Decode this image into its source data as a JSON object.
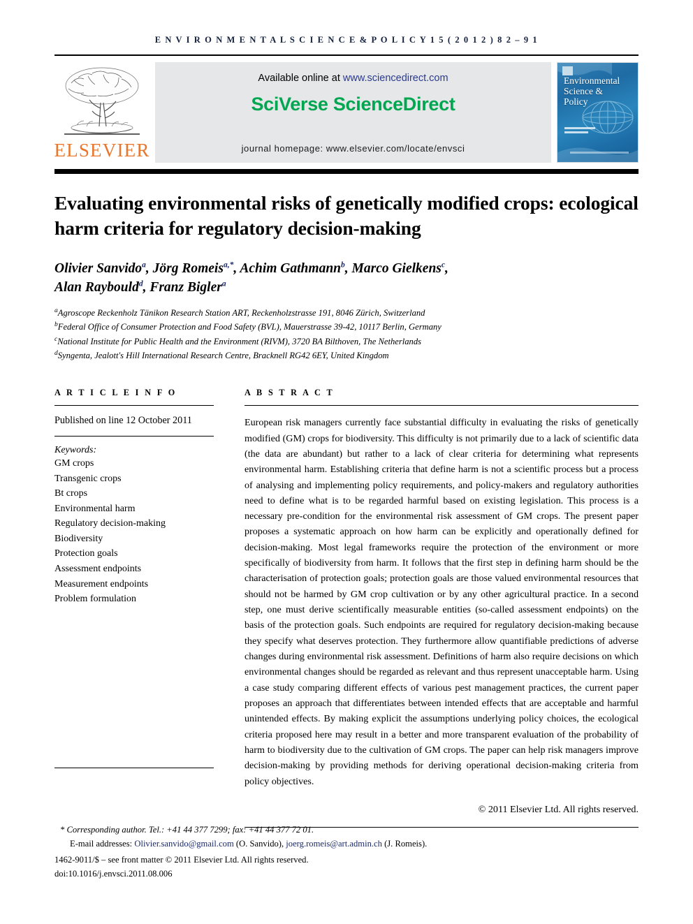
{
  "running_head": "E N V I R O N M E N T A L   S C I E N C E   &   P O L I C Y   1 5   ( 2 0 1 2 )   8 2 – 9 1",
  "masthead": {
    "elsevier_wordmark": "ELSEVIER",
    "available_online_label": "Available online at",
    "sciencedirect_url": "www.sciencedirect.com",
    "sciverse_logo": "SciVerse ScienceDirect",
    "journal_homepage": "journal homepage: www.elsevier.com/locate/envsci",
    "cover_title_line1": "Environmental",
    "cover_title_line2": "Science &",
    "cover_title_line3": "Policy"
  },
  "article": {
    "title": "Evaluating environmental risks of genetically modified crops: ecological harm criteria for regulatory decision-making",
    "authors_line1": "Olivier Sanvido",
    "authors_line1_sup1": "a",
    "authors_line1_b": ", Jörg Romeis",
    "authors_line1_sup2": "a,*",
    "authors_line1_c": ", Achim Gathmann",
    "authors_line1_sup3": "b",
    "authors_line1_d": ", Marco Gielkens",
    "authors_line1_sup4": "c",
    "authors_line1_e": ",",
    "authors_line2": "Alan Raybould",
    "authors_line2_sup1": "d",
    "authors_line2_b": ", Franz Bigler",
    "authors_line2_sup2": "a",
    "affiliations": [
      {
        "marker": "a",
        "text": "Agroscope Reckenholz Tänikon Research Station ART, Reckenholzstrasse 191, 8046 Zürich, Switzerland"
      },
      {
        "marker": "b",
        "text": "Federal Office of Consumer Protection and Food Safety (BVL), Mauerstrasse 39-42, 10117 Berlin, Germany"
      },
      {
        "marker": "c",
        "text": "National Institute for Public Health and the Environment (RIVM), 3720 BA Bilthoven, The Netherlands"
      },
      {
        "marker": "d",
        "text": "Syngenta, Jealott's Hill International Research Centre, Bracknell RG42 6EY, United Kingdom"
      }
    ]
  },
  "article_info": {
    "heading": "A R T I C L E   I N F O",
    "published": "Published on line 12 October 2011",
    "keywords_label": "Keywords:",
    "keywords": [
      "GM crops",
      "Transgenic crops",
      "Bt crops",
      "Environmental harm",
      "Regulatory decision-making",
      "Biodiversity",
      "Protection goals",
      "Assessment endpoints",
      "Measurement endpoints",
      "Problem formulation"
    ]
  },
  "abstract": {
    "heading": "A B S T R A C T",
    "body": "European risk managers currently face substantial difficulty in evaluating the risks of genetically modified (GM) crops for biodiversity. This difficulty is not primarily due to a lack of scientific data (the data are abundant) but rather to a lack of clear criteria for determining what represents environmental harm. Establishing criteria that define harm is not a scientific process but a process of analysing and implementing policy requirements, and policy-makers and regulatory authorities need to define what is to be regarded harmful based on existing legislation. This process is a necessary pre-condition for the environmental risk assessment of GM crops. The present paper proposes a systematic approach on how harm can be explicitly and operationally defined for decision-making. Most legal frameworks require the protection of the environment or more specifically of biodiversity from harm. It follows that the first step in defining harm should be the characterisation of protection goals; protection goals are those valued environmental resources that should not be harmed by GM crop cultivation or by any other agricultural practice. In a second step, one must derive scientifically measurable entities (so-called assessment endpoints) on the basis of the protection goals. Such endpoints are required for regulatory decision-making because they specify what deserves protection. They furthermore allow quantifiable predictions of adverse changes during environmental risk assessment. Definitions of harm also require decisions on which environmental changes should be regarded as relevant and thus represent unacceptable harm. Using a case study comparing different effects of various pest management practices, the current paper proposes an approach that differentiates between intended effects that are acceptable and harmful unintended effects. By making explicit the assumptions underlying policy choices, the ecological criteria proposed here may result in a better and more transparent evaluation of the probability of harm to biodiversity due to the cultivation of GM crops. The paper can help risk managers improve decision-making by providing methods for deriving operational decision-making criteria from policy objectives.",
    "copyright": "© 2011 Elsevier Ltd. All rights reserved."
  },
  "footnotes": {
    "corresponding_author": "* Corresponding author. Tel.: +41 44 377 7299; fax: +41 44 377 72 01.",
    "email_label": "E-mail addresses:",
    "email1": "Olivier.sanvido@gmail.com",
    "email1_owner": "(O. Sanvido),",
    "email2": "joerg.romeis@art.admin.ch",
    "email2_owner": "(J. Romeis).",
    "issn_line": "1462-9011/$ – see front matter © 2011 Elsevier Ltd. All rights reserved.",
    "doi_line": "doi:10.1016/j.envsci.2011.08.006"
  },
  "colors": {
    "elsevier_orange": "#E8762C",
    "sciverse_green": "#00A650",
    "link_blue": "#1b2a6b",
    "running_head": "#14213d",
    "banner_gray": "#e6e7e8"
  }
}
